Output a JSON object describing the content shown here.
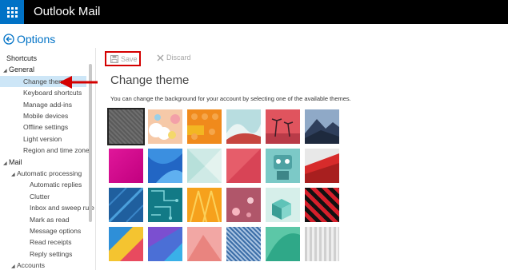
{
  "app": {
    "title": "Outlook Mail"
  },
  "header": {
    "title": "Options"
  },
  "sidebar": {
    "items": [
      {
        "label": "Shortcuts",
        "kind": "head"
      },
      {
        "label": "General",
        "kind": "group"
      },
      {
        "label": "Change theme",
        "kind": "item",
        "selected": true
      },
      {
        "label": "Keyboard shortcuts",
        "kind": "item"
      },
      {
        "label": "Manage add-ins",
        "kind": "item"
      },
      {
        "label": "Mobile devices",
        "kind": "item"
      },
      {
        "label": "Offline settings",
        "kind": "item"
      },
      {
        "label": "Light version",
        "kind": "item"
      },
      {
        "label": "Region and time zone",
        "kind": "item"
      },
      {
        "label": "Mail",
        "kind": "group"
      },
      {
        "label": "Automatic processing",
        "kind": "subgroup"
      },
      {
        "label": "Automatic replies",
        "kind": "subitem"
      },
      {
        "label": "Clutter",
        "kind": "subitem"
      },
      {
        "label": "Inbox and sweep rules",
        "kind": "subitem"
      },
      {
        "label": "Mark as read",
        "kind": "subitem"
      },
      {
        "label": "Message options",
        "kind": "subitem"
      },
      {
        "label": "Read receipts",
        "kind": "subitem"
      },
      {
        "label": "Reply settings",
        "kind": "subitem"
      },
      {
        "label": "Accounts",
        "kind": "subgroup"
      }
    ]
  },
  "toolbar": {
    "save_label": "Save",
    "discard_label": "Discard"
  },
  "main": {
    "title": "Change theme",
    "description": "You can change the background for your account by selecting one of the available themes."
  },
  "themes": [
    {
      "name": "gray",
      "selected": true
    },
    {
      "name": "cartoon-clouds"
    },
    {
      "name": "bricks"
    },
    {
      "name": "wave"
    },
    {
      "name": "palm-trees"
    },
    {
      "name": "mountains"
    },
    {
      "name": "magenta"
    },
    {
      "name": "blue-waves"
    },
    {
      "name": "pastel-shapes"
    },
    {
      "name": "red-geometric"
    },
    {
      "name": "robot"
    },
    {
      "name": "red-peaks"
    },
    {
      "name": "blue-pattern"
    },
    {
      "name": "circuit"
    },
    {
      "name": "orange-lines"
    },
    {
      "name": "pink-bokeh"
    },
    {
      "name": "teal-cubes"
    },
    {
      "name": "red-black-check"
    },
    {
      "name": "colorful-shapes"
    },
    {
      "name": "blue-purple-shapes"
    },
    {
      "name": "pink-triangles"
    },
    {
      "name": "blue-weave"
    },
    {
      "name": "green-leaf"
    },
    {
      "name": "gray-stripes"
    }
  ],
  "colors": {
    "topbar": "#000000",
    "launcher": "#0072c6",
    "accent": "#0072c6",
    "highlight": "#d40000",
    "selected_nav": "#cde6f7"
  }
}
